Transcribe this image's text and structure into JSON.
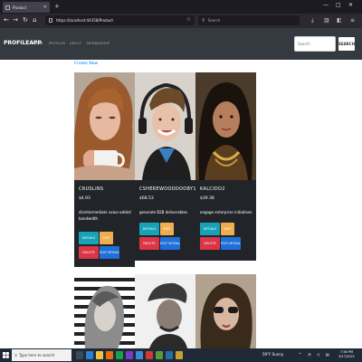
{
  "browser": {
    "tab_title": "Product",
    "url": "https://localhost:44358/Product",
    "search_placeholder": "Search",
    "new_tab_symbol": "+",
    "window_controls": [
      "—",
      "□",
      "✕"
    ]
  },
  "app": {
    "brand": "PROFILEAPP",
    "nav": [
      {
        "label": "HOME",
        "active": true
      },
      {
        "label": "PROFILES",
        "active": false
      },
      {
        "label": "ABOUT",
        "active": false
      },
      {
        "label": "MEMBERSHIP",
        "active": false
      }
    ],
    "search_placeholder": "Search",
    "search_button": "SEARCH",
    "create_link": "Create New"
  },
  "products": [
    {
      "name": "CRUSLINS",
      "price": "$4.93",
      "description": "disintermediate value-added bandwidth",
      "buttons": {
        "details": "DETAILS",
        "edit": "EDIT",
        "delete": "DELETE",
        "edit_modal": "EDIT MODAL"
      }
    },
    {
      "name": "CSHEREWOODDOOBY1",
      "price": "$68.53",
      "description": "generate B2B deliverables",
      "buttons": {
        "details": "DETAILS",
        "edit": "EDIT",
        "delete": "DELETE",
        "edit_modal": "EDIT MODAL"
      }
    },
    {
      "name": "KALCIDO2",
      "price": "$39.38",
      "description": "engage enterprise initiatives",
      "buttons": {
        "details": "DETAILS",
        "edit": "EDIT",
        "delete": "DELETE",
        "edit_modal": "EDIT MODAL"
      }
    }
  ],
  "taskbar": {
    "search_placeholder": "Type here to search",
    "weather": "59°F Sunny",
    "time": "7:56 PM",
    "date": "3/17/2021"
  },
  "colors": {
    "details": "#17a2b8",
    "edit": "#f0ad4e",
    "delete": "#dc3545",
    "edit_modal": "#1e6fd9",
    "card_bg": "#212529",
    "navbar_bg": "#343a40"
  }
}
